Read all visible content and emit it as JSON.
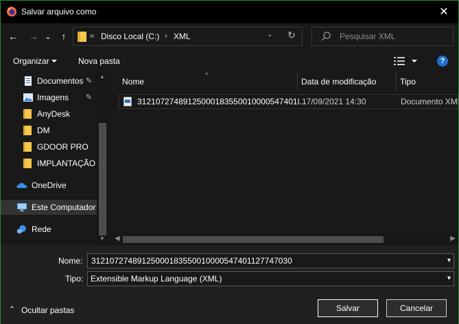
{
  "window": {
    "title": "Salvar arquivo como",
    "close_glyph": "✕",
    "app_icon": "firefox-icon"
  },
  "nav": {
    "back_glyph": "←",
    "forward_glyph": "→",
    "recent_glyph": "⌄",
    "up_glyph": "↑"
  },
  "address": {
    "overflow": "«",
    "segments": [
      "Disco Local (C:)",
      "XML"
    ],
    "separator": "›",
    "dropdown_glyph": "⌄",
    "refresh_glyph": "↻"
  },
  "search": {
    "placeholder": "Pesquisar XML"
  },
  "toolbar": {
    "organize_label": "Organizar",
    "new_folder_label": "Nova pasta",
    "help_label": "?"
  },
  "sidebar": {
    "items": [
      {
        "label": "Documentos",
        "icon": "documents-icon",
        "pinned": true
      },
      {
        "label": "Imagens",
        "icon": "pictures-icon",
        "pinned": true
      },
      {
        "label": "AnyDesk",
        "icon": "folder-icon",
        "pinned": false
      },
      {
        "label": "DM",
        "icon": "folder-icon",
        "pinned": false
      },
      {
        "label": "GDOOR PRO",
        "icon": "folder-icon",
        "pinned": false
      },
      {
        "label": "IMPLANTAÇÃO",
        "icon": "folder-icon",
        "pinned": false
      },
      {
        "label": "OneDrive",
        "icon": "cloud-icon",
        "pinned": false
      },
      {
        "label": "Este Computador",
        "icon": "computer-icon",
        "pinned": false
      },
      {
        "label": "Rede",
        "icon": "network-icon",
        "pinned": false
      }
    ],
    "pin_glyph": "📌"
  },
  "filelist": {
    "columns": [
      "Nome",
      "Data de modificação",
      "Tipo"
    ],
    "sort_glyph": "^",
    "rows": [
      {
        "name": "31210727489125000183550010000547401l...",
        "modified": "17/09/2021 14:30",
        "type": "Documento XML"
      }
    ]
  },
  "form": {
    "name_label": "Nome:",
    "name_value": "31210727489125000183550010000547401127747030",
    "type_label": "Tipo:",
    "type_value": "Extensible Markup Language (XML)"
  },
  "footer": {
    "hide_folders_label": "Ocultar pastas",
    "save_label": "Salvar",
    "cancel_label": "Cancelar"
  },
  "colors": {
    "accent_border": "#2b8a3e",
    "folder_yellow": "#f5c84c",
    "help_blue": "#1f6fd1"
  }
}
